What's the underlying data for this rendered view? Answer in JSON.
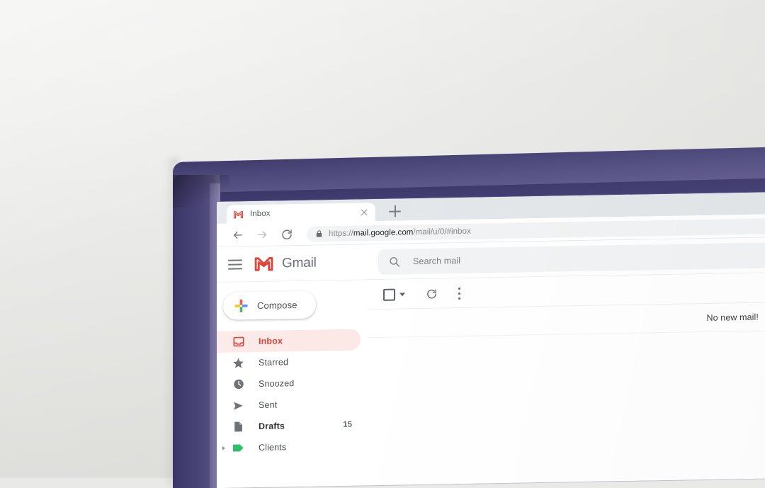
{
  "scene": {
    "description": "Photo of a monitor on a wall showing the Gmail inbox in a Chrome browser",
    "wall_color": "#e9e9e7",
    "bezel_color": "#443f72",
    "bezel_highlight": "#635e8f"
  },
  "browser": {
    "tab": {
      "title": "Inbox",
      "favicon": "gmail-icon",
      "close_label": "Close tab"
    },
    "new_tab_label": "New tab",
    "nav": {
      "back": "Back",
      "forward": "Forward",
      "reload": "Reload"
    },
    "omnibox": {
      "lock": "lock-icon",
      "scheme": "https://",
      "host": "mail.google.com",
      "path": "/mail/u/0/#inbox"
    }
  },
  "gmail": {
    "menu_label": "Main menu",
    "logo_label": "Gmail logo",
    "wordmark": "Gmail",
    "search": {
      "icon": "search-icon",
      "placeholder": "Search mail",
      "value": ""
    },
    "compose": {
      "label": "Compose",
      "icon": "plus-icon"
    },
    "nav_items": [
      {
        "label": "Inbox",
        "icon": "inbox-icon",
        "count": "",
        "active": true,
        "bold": true,
        "expandable": false
      },
      {
        "label": "Starred",
        "icon": "star-icon",
        "count": "",
        "active": false,
        "bold": false,
        "expandable": false
      },
      {
        "label": "Snoozed",
        "icon": "clock-icon",
        "count": "",
        "active": false,
        "bold": false,
        "expandable": false
      },
      {
        "label": "Sent",
        "icon": "send-icon",
        "count": "",
        "active": false,
        "bold": false,
        "expandable": false
      },
      {
        "label": "Drafts",
        "icon": "draft-icon",
        "count": "15",
        "active": false,
        "bold": true,
        "expandable": false
      },
      {
        "label": "Clients",
        "icon": "label-icon",
        "count": "",
        "active": false,
        "bold": false,
        "expandable": true,
        "label_color": "#19b95f"
      }
    ],
    "toolbar": {
      "select_all_label": "Select",
      "select_all_checked": false,
      "dropdown_label": "Selection options",
      "refresh_label": "Refresh",
      "more_label": "More options"
    },
    "empty_state": {
      "message": "No new mail!"
    },
    "colors": {
      "accent_red": "#d93025",
      "active_pill": "#fce8e6",
      "label_green": "#19b95f",
      "search_bg": "#f1f3f4"
    }
  }
}
